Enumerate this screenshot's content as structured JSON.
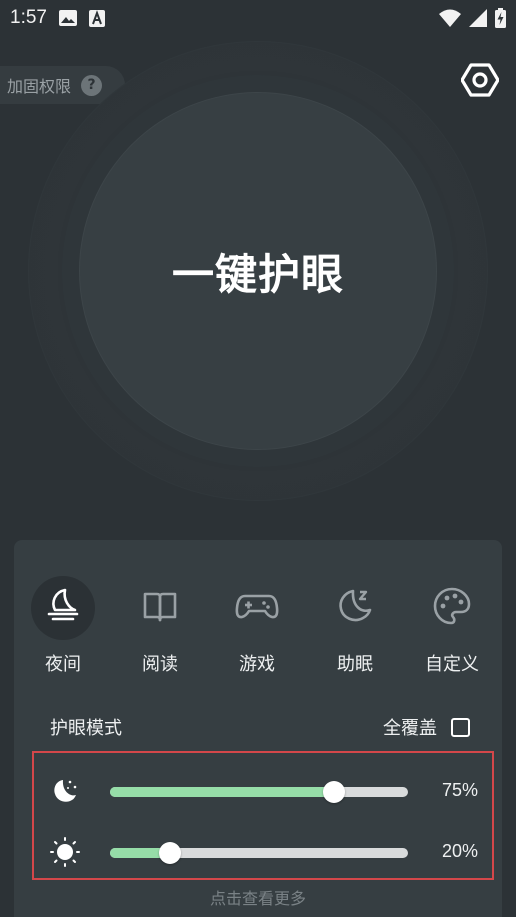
{
  "status_bar": {
    "time": "1:57",
    "icons": [
      "image-icon",
      "font-a-icon",
      "wifi-icon",
      "signal-icon",
      "battery-charging-icon"
    ]
  },
  "permission": {
    "label": "加固权限",
    "help": "?"
  },
  "main": {
    "button_label": "一键护眼"
  },
  "modes": [
    {
      "label": "夜间",
      "icon": "night-moon-icon",
      "active": true
    },
    {
      "label": "阅读",
      "icon": "book-icon",
      "active": false
    },
    {
      "label": "游戏",
      "icon": "gamepad-icon",
      "active": false
    },
    {
      "label": "助眠",
      "icon": "sleep-moon-icon",
      "active": false
    },
    {
      "label": "自定义",
      "icon": "palette-icon",
      "active": false
    }
  ],
  "eye_mode": {
    "title": "护眼模式",
    "full_cover_label": "全覆盖",
    "full_cover_checked": false
  },
  "sliders": {
    "filter": {
      "value": 0.75,
      "label": "75%",
      "icon": "moon-stars-icon"
    },
    "brightness": {
      "value": 0.2,
      "label": "20%",
      "icon": "sun-icon"
    }
  },
  "more_label": "点击查看更多",
  "colors": {
    "background": "#2c3236",
    "panel": "#363e42",
    "slider_fill": "#96dda8",
    "highlight_border": "#d4474a"
  }
}
